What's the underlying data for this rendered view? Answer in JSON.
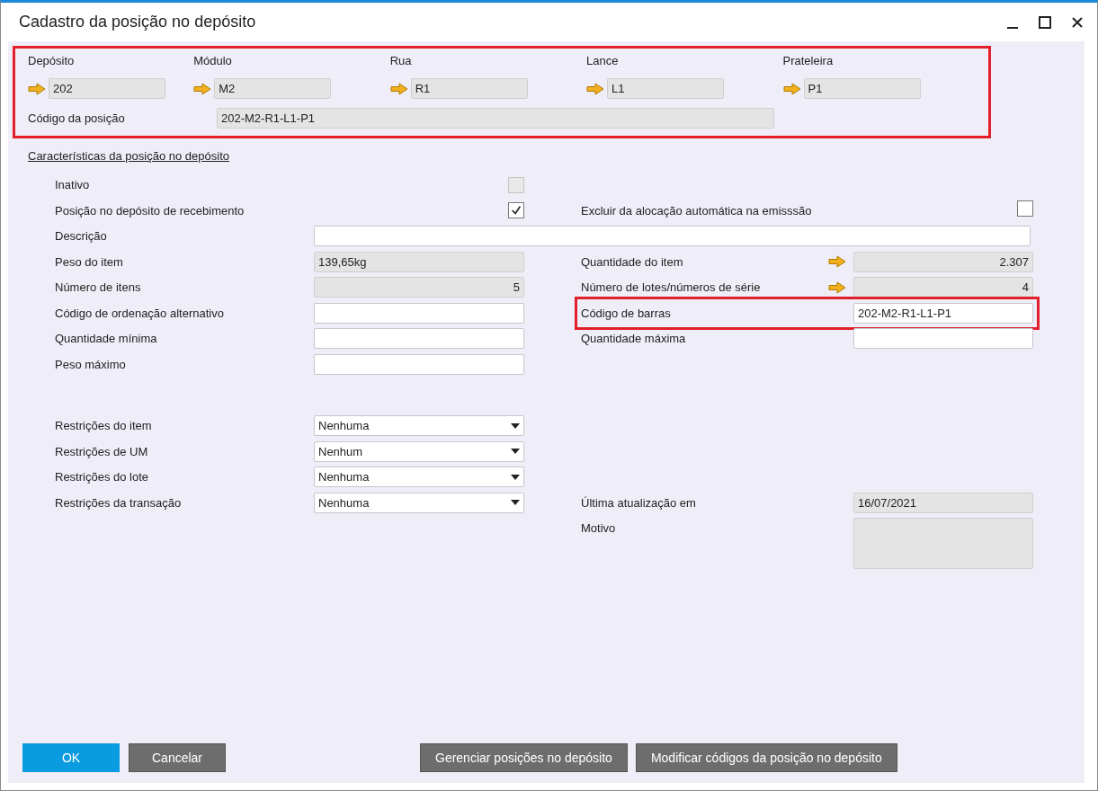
{
  "window": {
    "title": "Cadastro da posição no depósito"
  },
  "header": {
    "highlighted": true,
    "columns": [
      {
        "label": "Depósito",
        "value": "202"
      },
      {
        "label": "Módulo",
        "value": "M2"
      },
      {
        "label": "Rua",
        "value": "R1"
      },
      {
        "label": "Lance",
        "value": "L1"
      },
      {
        "label": "Prateleira",
        "value": "P1"
      }
    ],
    "code": {
      "label": "Código da posição",
      "value": "202-M2-R1-L1-P1"
    }
  },
  "section_title": "Características da posição no depósito",
  "rows": [
    {
      "left": {
        "kind": "checkbox",
        "label": "Inativo",
        "checked": false,
        "disabled": true
      }
    },
    {
      "left": {
        "kind": "checkbox",
        "label": "Posição no depósito de recebimento",
        "checked": true,
        "disabled": false
      },
      "right": {
        "kind": "checkbox",
        "label": "Excluir da alocação automática na emisssão",
        "checked": false,
        "disabled": false
      }
    },
    {
      "wide": {
        "label": "Descrição",
        "readonly": false
      }
    },
    {
      "left": {
        "kind": "text",
        "label": "Peso do item",
        "value": "139,65kg",
        "readonly": true,
        "right_aligned": false
      },
      "right": {
        "kind": "text",
        "label": "Quantidade do item",
        "value": "2.307",
        "readonly": true,
        "right_aligned": true,
        "link_arrow": true
      }
    },
    {
      "left": {
        "kind": "text",
        "label": "Número de itens",
        "value": "5",
        "readonly": true,
        "right_aligned": true
      },
      "right": {
        "kind": "text",
        "label": "Número de lotes/números de série",
        "value": "4",
        "readonly": true,
        "right_aligned": true,
        "link_arrow": true
      }
    },
    {
      "left": {
        "kind": "text",
        "label": "Código de ordenação alternativo",
        "readonly": false
      },
      "right": {
        "kind": "text",
        "label": "Código de barras",
        "value": "202-M2-R1-L1-P1",
        "readonly": false,
        "highlighted": true
      }
    },
    {
      "left": {
        "kind": "text",
        "label": "Quantidade mínima",
        "readonly": false
      },
      "right": {
        "kind": "text",
        "label": "Quantidade máxima",
        "readonly": false
      }
    },
    {
      "left": {
        "kind": "text",
        "label": "Peso máximo",
        "readonly": false
      }
    },
    {
      "gap_before": true,
      "left": {
        "kind": "combo",
        "label": "Restrições do item",
        "value": "Nenhuma"
      }
    },
    {
      "left": {
        "kind": "combo",
        "label": "Restrições de UM",
        "value": "Nenhum"
      }
    },
    {
      "left": {
        "kind": "combo",
        "label": "Restrições do lote",
        "value": "Nenhuma"
      }
    },
    {
      "left": {
        "kind": "combo",
        "label": "Restrições da transação",
        "value": "Nenhuma"
      },
      "right": {
        "kind": "text",
        "label": "Última atualização em",
        "value": "16/07/2021",
        "readonly": true
      }
    },
    {
      "right": {
        "kind": "textarea",
        "label": "Motivo",
        "readonly": true
      }
    }
  ],
  "buttons_left": [
    {
      "label": "OK",
      "kind": "primary"
    },
    {
      "label": "Cancelar",
      "kind": "secondary"
    }
  ],
  "buttons_right": [
    {
      "label": "Gerenciar posições no depósito",
      "kind": "secondary"
    },
    {
      "label": "Modificar códigos da posição no depósito",
      "kind": "secondary"
    }
  ]
}
